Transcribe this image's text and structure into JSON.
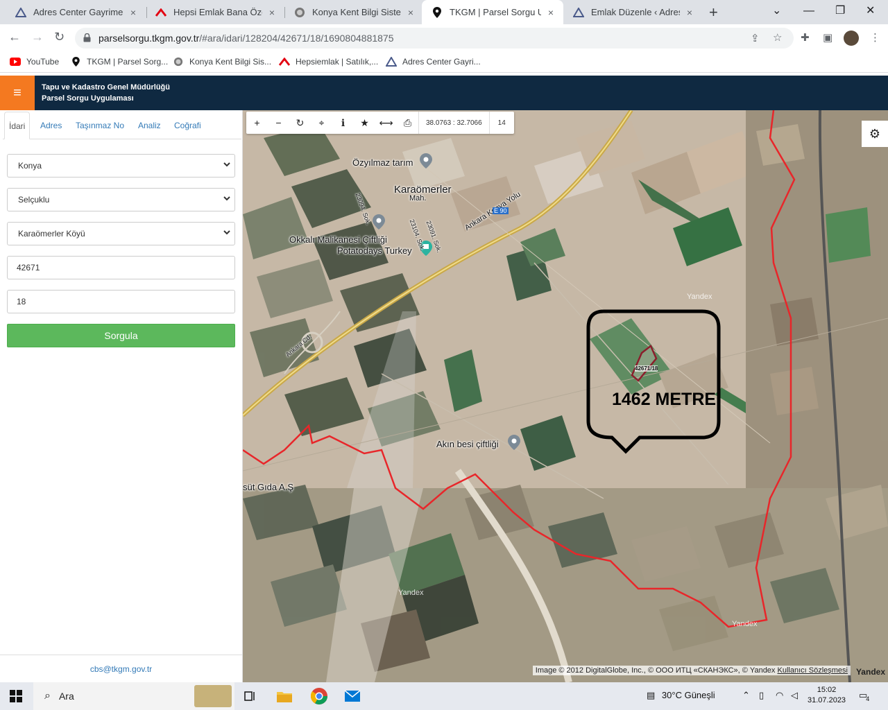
{
  "browser": {
    "tabs": [
      {
        "title": "Adres Center Gayrimenkul",
        "close": "×"
      },
      {
        "title": "Hepsi Emlak Bana Özel",
        "close": "×"
      },
      {
        "title": "Konya Kent Bilgi Sistemi",
        "close": "×"
      },
      {
        "title": "TKGM | Parsel Sorgu Uygu",
        "close": "×"
      },
      {
        "title": "Emlak Düzenle ‹ Adres Ce",
        "close": "×"
      }
    ],
    "new_tab": "+",
    "url_host": "parselsorgu.tkgm.gov.tr",
    "url_path": "/#ara/idari/128204/42671/18/1690804881875",
    "bookmarks": [
      {
        "label": "YouTube"
      },
      {
        "label": "TKGM | Parsel Sorg..."
      },
      {
        "label": "Konya Kent Bilgi Sis..."
      },
      {
        "label": "Hepsiemlak | Satılık,..."
      },
      {
        "label": "Adres Center Gayri..."
      }
    ]
  },
  "app": {
    "title_line1": "Tapu ve Kadastro Genel Müdürlüğü",
    "title_line2": "Parsel Sorgu Uygulaması"
  },
  "sidebar": {
    "tabs": [
      "İdari",
      "Adres",
      "Taşınmaz No",
      "Analiz",
      "Coğrafi"
    ],
    "active_tab": "İdari",
    "il": "Konya",
    "ilce": "Selçuklu",
    "mahalle": "Karaömerler Köyü",
    "ada": "42671",
    "parsel": "18",
    "submit": "Sorgula",
    "footer_email": "cbs@tkgm.gov.tr"
  },
  "map": {
    "coordinates": "38.0763 : 32.7066",
    "zoom": "14",
    "labels": {
      "ozyilmaz": "Özyılmaz tarım",
      "karaomerler": "Karaömerler",
      "mah": "Mah.",
      "okkali": "Okkalı Malikanesi Çiftliği",
      "potatodays": "Potatodays Turkey",
      "akin": "Akın besi çiftliği",
      "sut": "süt Gıda A.Ş",
      "road": "Ankara Konya Yolu",
      "road_num": "E 90",
      "sok1": "23094. Sok.",
      "sok2": "23104. Sok.",
      "sok3": "23091. Sok.",
      "ring": "Ankara Cd."
    },
    "parcel_label": "42671/18",
    "annotation": "1462 METRE",
    "attribution_text": "Image © 2012 DigitalGlobe, Inc., © ООО ИТЦ «СКАНЭКС», © Yandex",
    "attribution_link": "Kullanıcı Sözleşmesi",
    "yandex": "Yandex"
  },
  "taskbar": {
    "search_placeholder": "Ara",
    "weather": "30°C  Güneşli",
    "time": "15:02",
    "date": "31.07.2023",
    "notifications": "4"
  },
  "colors": {
    "header_bg": "#0f2941",
    "accent_orange": "#f47920",
    "submit_green": "#5cb85c",
    "link_blue": "#337ab7",
    "boundary_red": "#e8262a"
  }
}
